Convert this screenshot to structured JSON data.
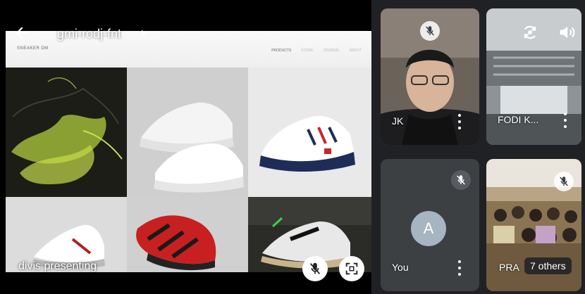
{
  "meeting": {
    "code": "gmi-rodj-fnt",
    "presenting_label": "divis presenting"
  },
  "slide": {
    "site_name": "SNEAKER DM",
    "nav": [
      "PRODUCTS",
      "STORE",
      "JOURNAL",
      "ABOUT"
    ]
  },
  "tiles": [
    {
      "name": "JK",
      "muted": true
    },
    {
      "name": "FODI K...",
      "muted": false
    },
    {
      "name": "You",
      "avatar_letter": "A",
      "muted": true
    },
    {
      "name": "PRA",
      "muted": true,
      "others_label": "7 others"
    }
  ],
  "icons": {
    "back": "arrow-left-icon",
    "chevron": "chevron-right-icon",
    "mic_off": "mic-off-icon",
    "fullscreen": "fullscreen-icon",
    "switch_camera": "switch-camera-icon",
    "volume": "volume-icon",
    "more": "more-vertical-icon"
  },
  "colors": {
    "background": "#202124",
    "avatar": "#a7b4c2"
  }
}
